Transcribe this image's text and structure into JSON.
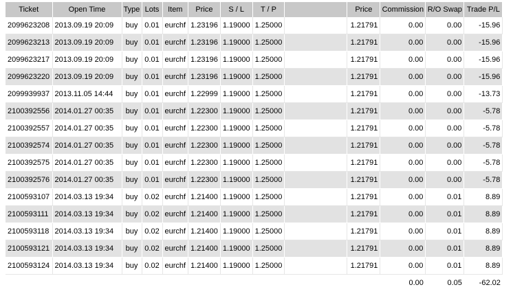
{
  "headers": {
    "ticket": "Ticket",
    "open_time": "Open Time",
    "type": "Type",
    "lots": "Lots",
    "item": "Item",
    "price": "Price",
    "sl": "S / L",
    "tp": "T / P",
    "blank": "",
    "close_price": "Price",
    "commission": "Commission",
    "swap": "R/O Swap",
    "pl": "Trade P/L"
  },
  "rows": [
    {
      "ticket": "2099623208",
      "open_time": "2013.09.19 20:09",
      "type": "buy",
      "lots": "0.01",
      "item": "eurchf",
      "price": "1.23196",
      "sl": "1.19000",
      "tp": "1.25000",
      "close_price": "1.21791",
      "commission": "0.00",
      "swap": "0.00",
      "pl": "-15.96"
    },
    {
      "ticket": "2099623213",
      "open_time": "2013.09.19 20:09",
      "type": "buy",
      "lots": "0.01",
      "item": "eurchf",
      "price": "1.23196",
      "sl": "1.19000",
      "tp": "1.25000",
      "close_price": "1.21791",
      "commission": "0.00",
      "swap": "0.00",
      "pl": "-15.96"
    },
    {
      "ticket": "2099623217",
      "open_time": "2013.09.19 20:09",
      "type": "buy",
      "lots": "0.01",
      "item": "eurchf",
      "price": "1.23196",
      "sl": "1.19000",
      "tp": "1.25000",
      "close_price": "1.21791",
      "commission": "0.00",
      "swap": "0.00",
      "pl": "-15.96"
    },
    {
      "ticket": "2099623220",
      "open_time": "2013.09.19 20:09",
      "type": "buy",
      "lots": "0.01",
      "item": "eurchf",
      "price": "1.23196",
      "sl": "1.19000",
      "tp": "1.25000",
      "close_price": "1.21791",
      "commission": "0.00",
      "swap": "0.00",
      "pl": "-15.96"
    },
    {
      "ticket": "2099939937",
      "open_time": "2013.11.05 14:44",
      "type": "buy",
      "lots": "0.01",
      "item": "eurchf",
      "price": "1.22999",
      "sl": "1.19000",
      "tp": "1.25000",
      "close_price": "1.21791",
      "commission": "0.00",
      "swap": "0.00",
      "pl": "-13.73"
    },
    {
      "ticket": "2100392556",
      "open_time": "2014.01.27 00:35",
      "type": "buy",
      "lots": "0.01",
      "item": "eurchf",
      "price": "1.22300",
      "sl": "1.19000",
      "tp": "1.25000",
      "close_price": "1.21791",
      "commission": "0.00",
      "swap": "0.00",
      "pl": "-5.78"
    },
    {
      "ticket": "2100392557",
      "open_time": "2014.01.27 00:35",
      "type": "buy",
      "lots": "0.01",
      "item": "eurchf",
      "price": "1.22300",
      "sl": "1.19000",
      "tp": "1.25000",
      "close_price": "1.21791",
      "commission": "0.00",
      "swap": "0.00",
      "pl": "-5.78"
    },
    {
      "ticket": "2100392574",
      "open_time": "2014.01.27 00:35",
      "type": "buy",
      "lots": "0.01",
      "item": "eurchf",
      "price": "1.22300",
      "sl": "1.19000",
      "tp": "1.25000",
      "close_price": "1.21791",
      "commission": "0.00",
      "swap": "0.00",
      "pl": "-5.78"
    },
    {
      "ticket": "2100392575",
      "open_time": "2014.01.27 00:35",
      "type": "buy",
      "lots": "0.01",
      "item": "eurchf",
      "price": "1.22300",
      "sl": "1.19000",
      "tp": "1.25000",
      "close_price": "1.21791",
      "commission": "0.00",
      "swap": "0.00",
      "pl": "-5.78"
    },
    {
      "ticket": "2100392576",
      "open_time": "2014.01.27 00:35",
      "type": "buy",
      "lots": "0.01",
      "item": "eurchf",
      "price": "1.22300",
      "sl": "1.19000",
      "tp": "1.25000",
      "close_price": "1.21791",
      "commission": "0.00",
      "swap": "0.00",
      "pl": "-5.78"
    },
    {
      "ticket": "2100593107",
      "open_time": "2014.03.13 19:34",
      "type": "buy",
      "lots": "0.02",
      "item": "eurchf",
      "price": "1.21400",
      "sl": "1.19000",
      "tp": "1.25000",
      "close_price": "1.21791",
      "commission": "0.00",
      "swap": "0.01",
      "pl": "8.89"
    },
    {
      "ticket": "2100593111",
      "open_time": "2014.03.13 19:34",
      "type": "buy",
      "lots": "0.02",
      "item": "eurchf",
      "price": "1.21400",
      "sl": "1.19000",
      "tp": "1.25000",
      "close_price": "1.21791",
      "commission": "0.00",
      "swap": "0.01",
      "pl": "8.89"
    },
    {
      "ticket": "2100593118",
      "open_time": "2014.03.13 19:34",
      "type": "buy",
      "lots": "0.02",
      "item": "eurchf",
      "price": "1.21400",
      "sl": "1.19000",
      "tp": "1.25000",
      "close_price": "1.21791",
      "commission": "0.00",
      "swap": "0.01",
      "pl": "8.89"
    },
    {
      "ticket": "2100593121",
      "open_time": "2014.03.13 19:34",
      "type": "buy",
      "lots": "0.02",
      "item": "eurchf",
      "price": "1.21400",
      "sl": "1.19000",
      "tp": "1.25000",
      "close_price": "1.21791",
      "commission": "0.00",
      "swap": "0.01",
      "pl": "8.89"
    },
    {
      "ticket": "2100593124",
      "open_time": "2014.03.13 19:34",
      "type": "buy",
      "lots": "0.02",
      "item": "eurchf",
      "price": "1.21400",
      "sl": "1.19000",
      "tp": "1.25000",
      "close_price": "1.21791",
      "commission": "0.00",
      "swap": "0.01",
      "pl": "8.89"
    }
  ],
  "totals": {
    "commission": "0.00",
    "swap": "0.05",
    "pl": "-62.02"
  },
  "colors": {
    "header_bg": "#c8c8c8",
    "row_alt_bg": "#e2e2e2",
    "row_bg": "#ffffff"
  }
}
